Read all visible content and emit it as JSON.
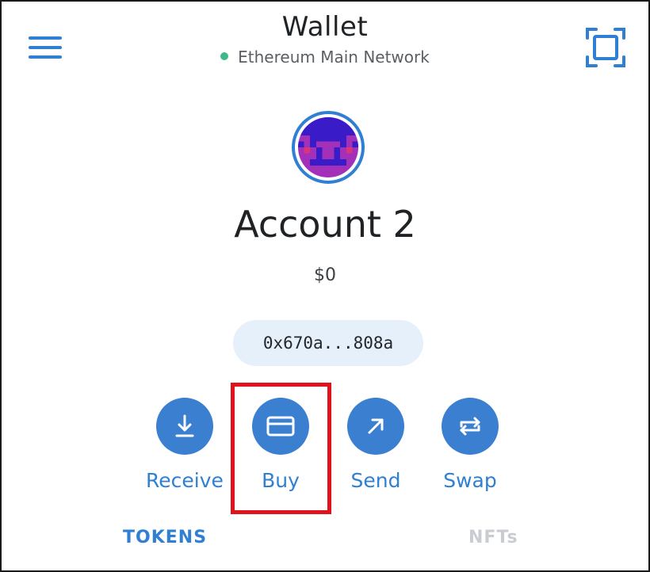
{
  "header": {
    "title": "Wallet",
    "network": "Ethereum Main Network",
    "menu_icon": "hamburger-menu-icon",
    "scan_icon": "qr-scan-icon"
  },
  "account": {
    "name": "Account 2",
    "balance": "$0",
    "address": "0x670a...808a"
  },
  "actions": [
    {
      "label": "Receive",
      "icon": "download-arrow-icon"
    },
    {
      "label": "Buy",
      "icon": "credit-card-icon"
    },
    {
      "label": "Send",
      "icon": "arrow-up-right-icon"
    },
    {
      "label": "Swap",
      "icon": "swap-arrows-icon"
    }
  ],
  "tabs": [
    {
      "label": "TOKENS",
      "active": true
    },
    {
      "label": "NFTs",
      "active": false
    }
  ],
  "colors": {
    "accent": "#2f7fd3",
    "button": "#3a7fd0",
    "network_dot": "#3fb88a",
    "highlight": "#e0121b",
    "pill": "#e6f0fa"
  }
}
